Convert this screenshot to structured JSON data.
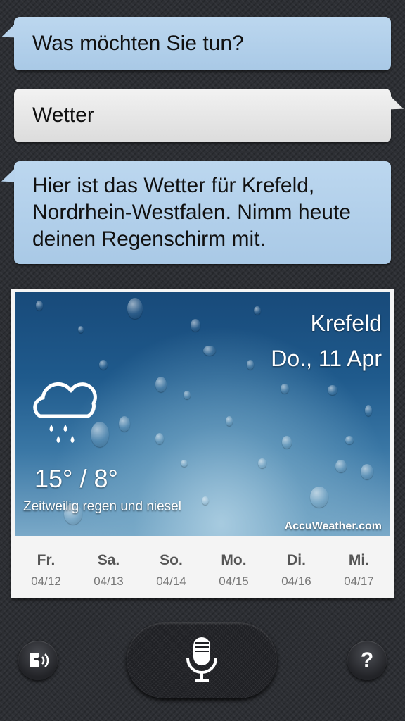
{
  "conversation": {
    "prompt": "Was möchten Sie tun?",
    "user_query": "Wetter",
    "response": "Hier ist das Wetter für Krefeld, Nordrhein-Westfalen. Nimm heute deinen Regenschirm mit."
  },
  "weather": {
    "city": "Krefeld",
    "date": "Do., 11 Apr",
    "temperature": "15° / 8°",
    "condition": "Zeitweilig regen und niesel",
    "icon": "rain-cloud-icon",
    "provider": "AccuWeather.com",
    "forecast": [
      {
        "day": "Fr.",
        "date": "04/12"
      },
      {
        "day": "Sa.",
        "date": "04/13"
      },
      {
        "day": "So.",
        "date": "04/14"
      },
      {
        "day": "Mo.",
        "date": "04/15"
      },
      {
        "day": "Di.",
        "date": "04/16"
      },
      {
        "day": "Mi.",
        "date": "04/17"
      }
    ]
  },
  "controls": {
    "speaker_icon": "speaker-feedback-icon",
    "mic_icon": "microphone-icon",
    "help_label": "?"
  },
  "colors": {
    "assistant_bubble": "#b3d0ea",
    "user_bubble": "#e6e6e6",
    "background": "#2d2f34"
  }
}
